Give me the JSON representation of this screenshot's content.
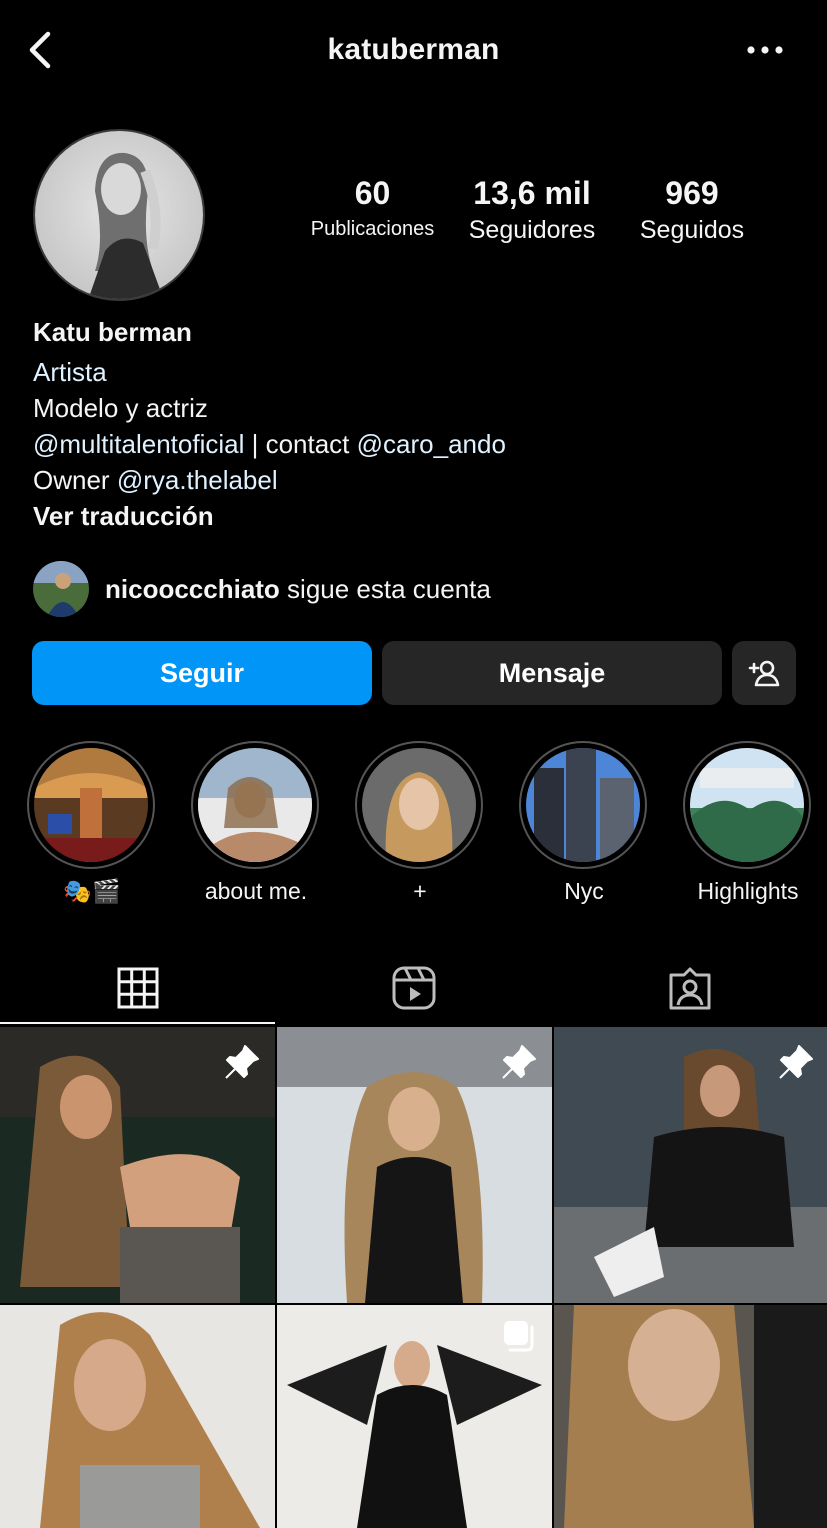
{
  "header": {
    "username": "katuberman",
    "back_icon": "chevron-left-icon",
    "more_icon": "more-horizontal-icon"
  },
  "stats": {
    "posts_count": "60",
    "posts_label": "Publicaciones",
    "followers_count": "13,6 mil",
    "followers_label": "Seguidores",
    "following_count": "969",
    "following_label": "Seguidos"
  },
  "bio": {
    "name": "Katu berman",
    "category": "Artista",
    "line1": "Modelo y actriz",
    "line2_mention1": "@multitalentoficial",
    "line2_sep": " | contact ",
    "line2_mention2": "@caro_ando",
    "line3_prefix": "Owner ",
    "line3_mention": "@rya.thelabel",
    "translate": "Ver traducción"
  },
  "followed_by": {
    "username": "nicooccchiato",
    "text": " sigue esta cuenta"
  },
  "actions": {
    "follow": "Seguir",
    "message": "Mensaje",
    "suggest_icon": "add-person-icon"
  },
  "highlights": [
    {
      "label": "🎭🎬"
    },
    {
      "label": "about me."
    },
    {
      "label": "+"
    },
    {
      "label": "Nyc"
    },
    {
      "label": "Highlights"
    }
  ],
  "tabs": [
    {
      "icon": "grid-icon",
      "active": true
    },
    {
      "icon": "reels-icon",
      "active": false
    },
    {
      "icon": "tagged-icon",
      "active": false
    }
  ],
  "posts": [
    {
      "pinned": true,
      "multi": false
    },
    {
      "pinned": true,
      "multi": false
    },
    {
      "pinned": true,
      "multi": false
    },
    {
      "pinned": false,
      "multi": false
    },
    {
      "pinned": false,
      "multi": true
    },
    {
      "pinned": false,
      "multi": false
    }
  ],
  "colors": {
    "accent": "#0095f6",
    "button_dark": "#262626",
    "background": "#000000",
    "link": "#e0f1ff"
  }
}
